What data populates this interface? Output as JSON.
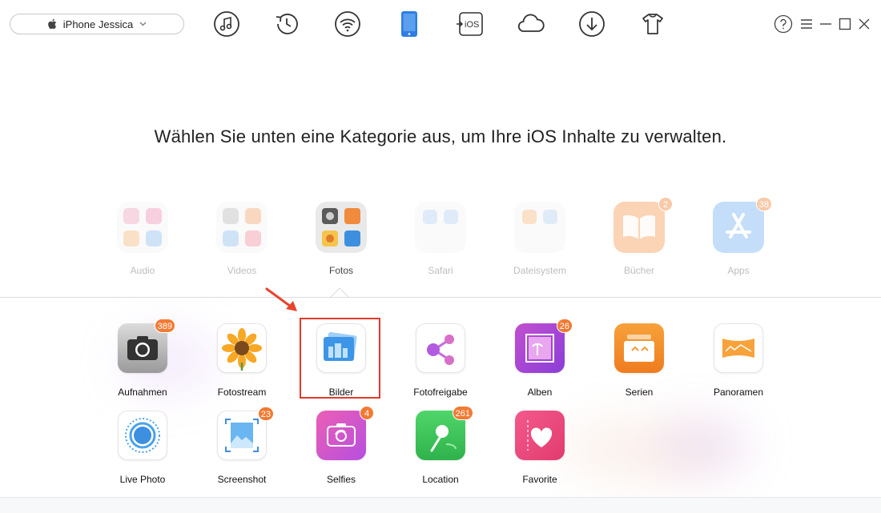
{
  "device": {
    "name": "iPhone Jessica"
  },
  "headline": "Wählen Sie unten eine Kategorie aus, um Ihre iOS Inhalte zu verwalten.",
  "toolbar": [
    {
      "icon": "music-icon"
    },
    {
      "icon": "history-icon"
    },
    {
      "icon": "wifi-icon"
    },
    {
      "icon": "phone-icon",
      "active": true
    },
    {
      "icon": "ios-transfer-icon",
      "text": "iOS"
    },
    {
      "icon": "cloud-icon"
    },
    {
      "icon": "download-icon"
    },
    {
      "icon": "tshirt-icon"
    }
  ],
  "categories": [
    {
      "label": "Audio"
    },
    {
      "label": "Videos"
    },
    {
      "label": "Fotos",
      "active": true
    },
    {
      "label": "Safari"
    },
    {
      "label": "Dateisystem"
    },
    {
      "label": "Bücher",
      "badge": "2"
    },
    {
      "label": "Apps",
      "badge": "38"
    }
  ],
  "photos": [
    {
      "label": "Aufnahmen",
      "badge": "389"
    },
    {
      "label": "Fotostream"
    },
    {
      "label": "Bilder",
      "selected": true
    },
    {
      "label": "Fotofreigabe"
    },
    {
      "label": "Alben",
      "badge": "26"
    },
    {
      "label": "Serien"
    },
    {
      "label": "Panoramen"
    },
    {
      "label": "Live Photo"
    },
    {
      "label": "Screenshot",
      "badge": "23"
    },
    {
      "label": "Selfies",
      "badge": "4"
    },
    {
      "label": "Location",
      "badge": "261"
    },
    {
      "label": "Favorite"
    }
  ],
  "colors": {
    "accent": "#2f7de1",
    "badge": "#f27a32",
    "selection": "#e23a2a"
  }
}
